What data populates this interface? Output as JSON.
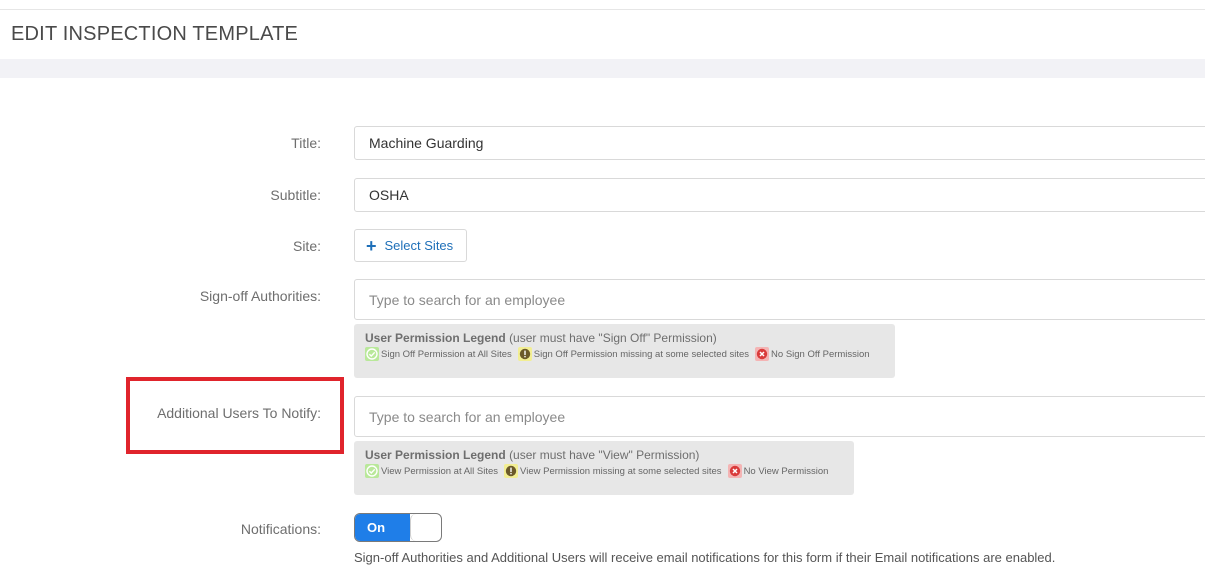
{
  "header": {
    "title": "EDIT INSPECTION TEMPLATE"
  },
  "form": {
    "title": {
      "label": "Title:",
      "value": "Machine Guarding"
    },
    "subtitle": {
      "label": "Subtitle:",
      "value": "OSHA"
    },
    "site": {
      "label": "Site:",
      "button_label": "Select Sites",
      "button_icon": "plus-icon"
    },
    "signoff": {
      "label": "Sign-off Authorities:",
      "placeholder": "Type to search for an employee",
      "legend": {
        "title": "User Permission Legend",
        "note": "(user must have \"Sign Off\" Permission)",
        "items": [
          {
            "icon": "check-icon",
            "text": "Sign Off Permission at All Sites"
          },
          {
            "icon": "warning-icon",
            "text": "Sign Off Permission missing at some selected sites"
          },
          {
            "icon": "x-icon",
            "text": "No Sign Off Permission"
          }
        ]
      }
    },
    "notify": {
      "label": "Additional Users To Notify:",
      "placeholder": "Type to search for an employee",
      "legend": {
        "title": "User Permission Legend",
        "note": "(user must have \"View\" Permission)",
        "items": [
          {
            "icon": "check-icon",
            "text": "View Permission at All Sites"
          },
          {
            "icon": "warning-icon",
            "text": "View Permission missing at some selected sites"
          },
          {
            "icon": "x-icon",
            "text": "No View Permission"
          }
        ]
      }
    },
    "notifications": {
      "label": "Notifications:",
      "toggle_label": "On",
      "enabled": true,
      "help": "Sign-off Authorities and Additional Users will receive email notifications for this form if their Email notifications are enabled."
    }
  },
  "colors": {
    "accent": "#1f7ee8",
    "link": "#1e6fb8",
    "highlight": "#e0242c",
    "legend_green": "#b9e89a",
    "legend_yellow": "#f2ee93",
    "legend_red": "#f4b4b4"
  }
}
